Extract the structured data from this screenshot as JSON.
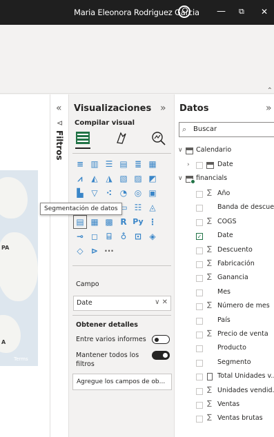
{
  "titlebar": {
    "user_name": "Maria Eleonora Rodriguez Garcia",
    "minimize": "—",
    "restore": "⧉",
    "close": "✕"
  },
  "ribbon": {
    "more_icon": "⌃"
  },
  "map": {
    "labels": [
      "PA",
      "A"
    ],
    "terms": "Terms"
  },
  "filters_pane": {
    "collapse_icon": "«",
    "funnel_icon": "⊲",
    "label": "Filtros"
  },
  "visualizations": {
    "title": "Visualizaciones",
    "collapse_icon": "»",
    "build_visual_label": "Compilar visual",
    "tooltip": "Segmentación de datos",
    "field_section_label": "Campo",
    "field_value": "Date",
    "field_controls": "∨ ✕",
    "drillthrough_title": "Obtener detalles",
    "cross_report_label": "Entre varios informes",
    "keep_filters_label": "Mantener todos los filtros",
    "drop_placeholder": "Agregue los campos de ob...",
    "more_visuals": "···"
  },
  "data_pane": {
    "title": "Datos",
    "collapse_icon": "»",
    "search_placeholder": "Buscar",
    "tables": [
      {
        "name": "Calendario",
        "expanded": true,
        "fields": [
          {
            "name": "Date",
            "type": "date",
            "checked": false
          }
        ]
      },
      {
        "name": "financials",
        "expanded": true,
        "fields": [
          {
            "name": "Año",
            "sigma": true,
            "checked": false
          },
          {
            "name": "Banda de descue...",
            "sigma": false,
            "checked": false
          },
          {
            "name": "COGS",
            "sigma": true,
            "checked": false
          },
          {
            "name": "Date",
            "sigma": false,
            "checked": true
          },
          {
            "name": "Descuento",
            "sigma": true,
            "checked": false
          },
          {
            "name": "Fabricación",
            "sigma": true,
            "checked": false
          },
          {
            "name": "Ganancia",
            "sigma": true,
            "checked": false
          },
          {
            "name": "Mes",
            "sigma": false,
            "checked": false
          },
          {
            "name": "Número de mes",
            "sigma": true,
            "checked": false
          },
          {
            "name": "País",
            "sigma": false,
            "checked": false
          },
          {
            "name": "Precio de venta",
            "sigma": true,
            "checked": false
          },
          {
            "name": "Producto",
            "sigma": false,
            "checked": false
          },
          {
            "name": "Segmento",
            "sigma": false,
            "checked": false
          },
          {
            "name": "Total Unidades v...",
            "sigma": false,
            "calc": true,
            "checked": false
          },
          {
            "name": "Unidades vendid...",
            "sigma": true,
            "checked": false
          },
          {
            "name": "Ventas",
            "sigma": true,
            "checked": false
          },
          {
            "name": "Ventas brutas",
            "sigma": true,
            "checked": false
          }
        ]
      }
    ]
  }
}
